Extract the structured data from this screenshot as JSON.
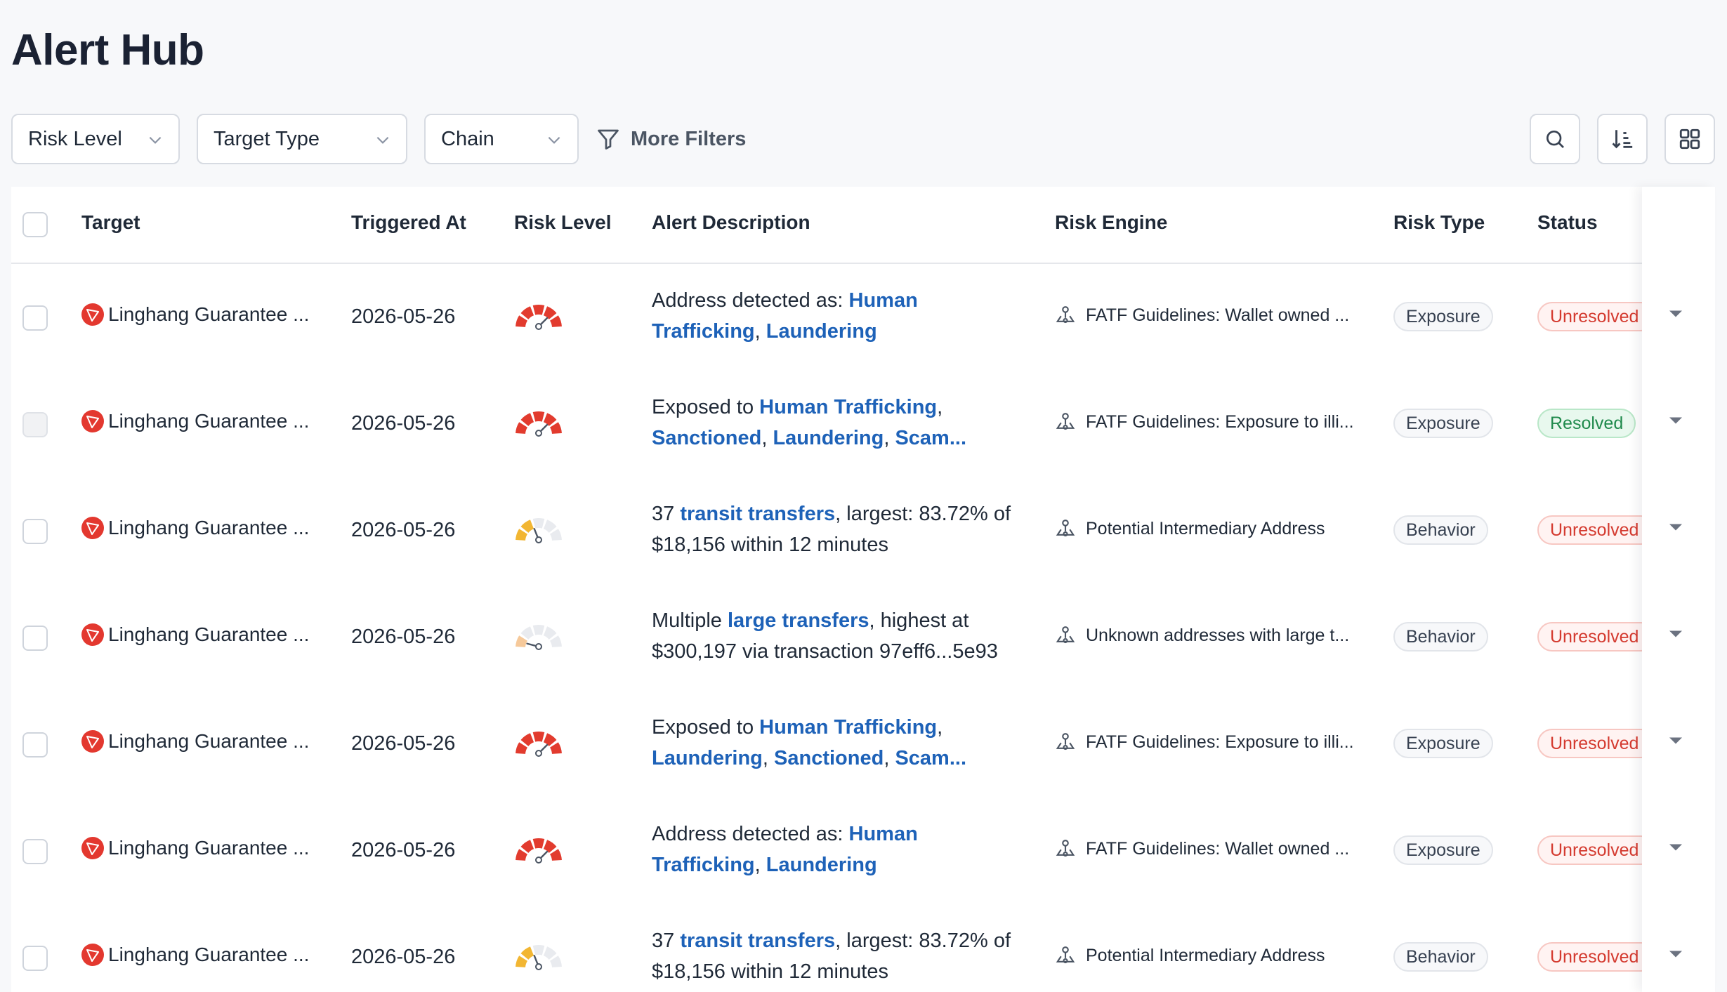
{
  "page": {
    "title": "Alert Hub"
  },
  "filters": {
    "risk_level": "Risk Level",
    "target_type": "Target Type",
    "chain": "Chain",
    "more_filters": "More Filters"
  },
  "table": {
    "headers": {
      "target": "Target",
      "triggered_at": "Triggered At",
      "risk_level": "Risk Level",
      "alert_description": "Alert Description",
      "risk_engine": "Risk Engine",
      "risk_type": "Risk Type",
      "status": "Status"
    },
    "rows": [
      {
        "target": "Linghang Guarantee ...",
        "date": "2026-05-26",
        "risk": "high",
        "desc": [
          {
            "t": "Address detected as: "
          },
          {
            "t": "Human Trafficking",
            "link": true
          },
          {
            "t": ", "
          },
          {
            "t": "Laundering",
            "link": true
          }
        ],
        "engine": "FATF Guidelines: Wallet owned ...",
        "type": "Exposure",
        "status": "Unresolved",
        "disabled": false
      },
      {
        "target": "Linghang Guarantee ...",
        "date": "2026-05-26",
        "risk": "high",
        "desc": [
          {
            "t": "Exposed to "
          },
          {
            "t": "Human Trafficking",
            "link": true
          },
          {
            "t": ", "
          },
          {
            "t": "Sanctioned",
            "link": true
          },
          {
            "t": ", "
          },
          {
            "t": "Laundering",
            "link": true
          },
          {
            "t": ", "
          },
          {
            "t": "Scam...",
            "link": true
          }
        ],
        "engine": "FATF Guidelines: Exposure to illi...",
        "type": "Exposure",
        "status": "Resolved",
        "disabled": true
      },
      {
        "target": "Linghang Guarantee ...",
        "date": "2026-05-26",
        "risk": "medium",
        "desc": [
          {
            "t": "37 "
          },
          {
            "t": "transit transfers",
            "link": true
          },
          {
            "t": ", largest: 83.72% of $18,156 within 12 minutes"
          }
        ],
        "engine": "Potential Intermediary Address",
        "type": "Behavior",
        "status": "Unresolved",
        "disabled": false
      },
      {
        "target": "Linghang Guarantee ...",
        "date": "2026-05-26",
        "risk": "low",
        "desc": [
          {
            "t": "Multiple "
          },
          {
            "t": "large transfers",
            "link": true
          },
          {
            "t": ", highest at $300,197 via transaction 97eff6...5e93"
          }
        ],
        "engine": "Unknown addresses with large t...",
        "type": "Behavior",
        "status": "Unresolved",
        "disabled": false
      },
      {
        "target": "Linghang Guarantee ...",
        "date": "2026-05-26",
        "risk": "high",
        "desc": [
          {
            "t": "Exposed to "
          },
          {
            "t": "Human Trafficking",
            "link": true
          },
          {
            "t": ", "
          },
          {
            "t": "Laundering",
            "link": true
          },
          {
            "t": ", "
          },
          {
            "t": "Sanctioned",
            "link": true
          },
          {
            "t": ", "
          },
          {
            "t": "Scam...",
            "link": true
          }
        ],
        "engine": "FATF Guidelines: Exposure to illi...",
        "type": "Exposure",
        "status": "Unresolved",
        "disabled": false
      },
      {
        "target": "Linghang Guarantee ...",
        "date": "2026-05-26",
        "risk": "high",
        "desc": [
          {
            "t": "Address detected as: "
          },
          {
            "t": "Human Trafficking",
            "link": true
          },
          {
            "t": ", "
          },
          {
            "t": "Laundering",
            "link": true
          }
        ],
        "engine": "FATF Guidelines: Wallet owned ...",
        "type": "Exposure",
        "status": "Unresolved",
        "disabled": false
      },
      {
        "target": "Linghang Guarantee ...",
        "date": "2026-05-26",
        "risk": "medium",
        "desc": [
          {
            "t": "37 "
          },
          {
            "t": "transit transfers",
            "link": true
          },
          {
            "t": ", largest: 83.72% of $18,156 within 12 minutes"
          }
        ],
        "engine": "Potential Intermediary Address",
        "type": "Behavior",
        "status": "Unresolved",
        "disabled": false
      }
    ]
  },
  "colors": {
    "accent_link": "#1e62b8",
    "risk_high": "#e23b2e",
    "risk_medium": "#f2b632",
    "risk_low": "#f6c99a",
    "unresolved": "#d43a2f",
    "resolved": "#1f8a4c"
  }
}
